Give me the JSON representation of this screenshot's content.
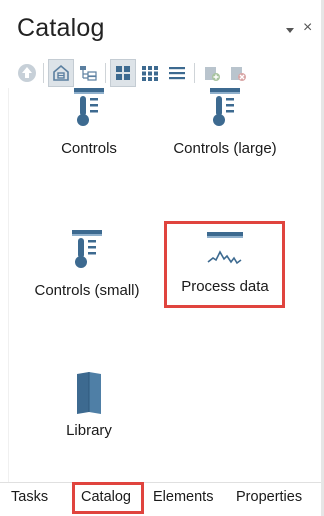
{
  "panel": {
    "title": "Catalog",
    "pin_icon": "dropdown-arrow-icon",
    "close_glyph": "×"
  },
  "toolbar": {
    "buttons": [
      {
        "name": "up-icon",
        "active": false
      },
      {
        "name": "home-folder-icon",
        "active": true
      },
      {
        "name": "tree-view-icon",
        "active": false
      },
      {
        "name": "large-icons-view-icon",
        "active": true
      },
      {
        "name": "small-icons-view-icon",
        "active": false
      },
      {
        "name": "list-view-icon",
        "active": false
      },
      {
        "name": "add-library-icon",
        "active": false
      },
      {
        "name": "remove-library-icon",
        "active": false
      }
    ]
  },
  "catalog": {
    "items": [
      {
        "label": "Controls",
        "icon": "thermometer-list-icon"
      },
      {
        "label": "Controls (large)",
        "icon": "thermometer-list-icon"
      },
      {
        "label": "Controls (small)",
        "icon": "thermometer-list-icon"
      },
      {
        "label": "Process data",
        "icon": "process-trend-icon",
        "highlighted": true
      },
      {
        "label": "Library",
        "icon": "book-icon"
      }
    ]
  },
  "tabs": [
    {
      "label": "Tasks"
    },
    {
      "label": "Catalog",
      "selected": true
    },
    {
      "label": "Elements"
    },
    {
      "label": "Properties"
    }
  ],
  "colors": {
    "icon_blue": "#4f7fa6",
    "icon_dark": "#3d6a90",
    "highlight_red": "#e0443e"
  }
}
